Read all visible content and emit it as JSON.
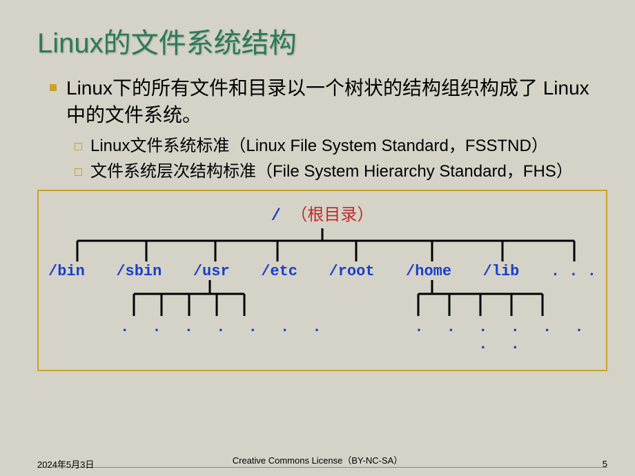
{
  "title": "Linux的文件系统结构",
  "main_bullet": "Linux下的所有文件和目录以一个树状的结构组织构成了 Linux 中的文件系统。",
  "sub_bullets": [
    "Linux文件系统标准（Linux File System Standard，FSSTND）",
    "文件系统层次结构标准（File System Hierarchy Standard，FHS）"
  ],
  "tree": {
    "root_symbol": "/",
    "root_label": "（根目录）",
    "dirs": [
      "/bin",
      "/sbin",
      "/usr",
      "/etc",
      "/root",
      "/home",
      "/lib",
      ". . ."
    ],
    "sub_dots_left": ". . . . . . .",
    "sub_dots_right": ". . . . . . . ."
  },
  "footer": {
    "date": "2024年5月3日",
    "license": "Creative Commons License（BY-NC-SA）",
    "page": "5"
  }
}
